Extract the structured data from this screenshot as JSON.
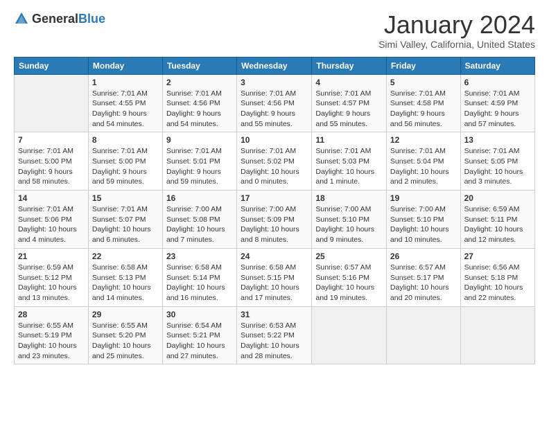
{
  "header": {
    "logo": {
      "general": "General",
      "blue": "Blue"
    },
    "title": "January 2024",
    "location": "Simi Valley, California, United States"
  },
  "calendar": {
    "weekdays": [
      "Sunday",
      "Monday",
      "Tuesday",
      "Wednesday",
      "Thursday",
      "Friday",
      "Saturday"
    ],
    "weeks": [
      [
        {
          "day": "",
          "info": ""
        },
        {
          "day": "1",
          "info": "Sunrise: 7:01 AM\nSunset: 4:55 PM\nDaylight: 9 hours\nand 54 minutes."
        },
        {
          "day": "2",
          "info": "Sunrise: 7:01 AM\nSunset: 4:56 PM\nDaylight: 9 hours\nand 54 minutes."
        },
        {
          "day": "3",
          "info": "Sunrise: 7:01 AM\nSunset: 4:56 PM\nDaylight: 9 hours\nand 55 minutes."
        },
        {
          "day": "4",
          "info": "Sunrise: 7:01 AM\nSunset: 4:57 PM\nDaylight: 9 hours\nand 55 minutes."
        },
        {
          "day": "5",
          "info": "Sunrise: 7:01 AM\nSunset: 4:58 PM\nDaylight: 9 hours\nand 56 minutes."
        },
        {
          "day": "6",
          "info": "Sunrise: 7:01 AM\nSunset: 4:59 PM\nDaylight: 9 hours\nand 57 minutes."
        }
      ],
      [
        {
          "day": "7",
          "info": "Sunrise: 7:01 AM\nSunset: 5:00 PM\nDaylight: 9 hours\nand 58 minutes."
        },
        {
          "day": "8",
          "info": "Sunrise: 7:01 AM\nSunset: 5:00 PM\nDaylight: 9 hours\nand 59 minutes."
        },
        {
          "day": "9",
          "info": "Sunrise: 7:01 AM\nSunset: 5:01 PM\nDaylight: 9 hours\nand 59 minutes."
        },
        {
          "day": "10",
          "info": "Sunrise: 7:01 AM\nSunset: 5:02 PM\nDaylight: 10 hours\nand 0 minutes."
        },
        {
          "day": "11",
          "info": "Sunrise: 7:01 AM\nSunset: 5:03 PM\nDaylight: 10 hours\nand 1 minute."
        },
        {
          "day": "12",
          "info": "Sunrise: 7:01 AM\nSunset: 5:04 PM\nDaylight: 10 hours\nand 2 minutes."
        },
        {
          "day": "13",
          "info": "Sunrise: 7:01 AM\nSunset: 5:05 PM\nDaylight: 10 hours\nand 3 minutes."
        }
      ],
      [
        {
          "day": "14",
          "info": "Sunrise: 7:01 AM\nSunset: 5:06 PM\nDaylight: 10 hours\nand 4 minutes."
        },
        {
          "day": "15",
          "info": "Sunrise: 7:01 AM\nSunset: 5:07 PM\nDaylight: 10 hours\nand 6 minutes."
        },
        {
          "day": "16",
          "info": "Sunrise: 7:00 AM\nSunset: 5:08 PM\nDaylight: 10 hours\nand 7 minutes."
        },
        {
          "day": "17",
          "info": "Sunrise: 7:00 AM\nSunset: 5:09 PM\nDaylight: 10 hours\nand 8 minutes."
        },
        {
          "day": "18",
          "info": "Sunrise: 7:00 AM\nSunset: 5:10 PM\nDaylight: 10 hours\nand 9 minutes."
        },
        {
          "day": "19",
          "info": "Sunrise: 7:00 AM\nSunset: 5:10 PM\nDaylight: 10 hours\nand 10 minutes."
        },
        {
          "day": "20",
          "info": "Sunrise: 6:59 AM\nSunset: 5:11 PM\nDaylight: 10 hours\nand 12 minutes."
        }
      ],
      [
        {
          "day": "21",
          "info": "Sunrise: 6:59 AM\nSunset: 5:12 PM\nDaylight: 10 hours\nand 13 minutes."
        },
        {
          "day": "22",
          "info": "Sunrise: 6:58 AM\nSunset: 5:13 PM\nDaylight: 10 hours\nand 14 minutes."
        },
        {
          "day": "23",
          "info": "Sunrise: 6:58 AM\nSunset: 5:14 PM\nDaylight: 10 hours\nand 16 minutes."
        },
        {
          "day": "24",
          "info": "Sunrise: 6:58 AM\nSunset: 5:15 PM\nDaylight: 10 hours\nand 17 minutes."
        },
        {
          "day": "25",
          "info": "Sunrise: 6:57 AM\nSunset: 5:16 PM\nDaylight: 10 hours\nand 19 minutes."
        },
        {
          "day": "26",
          "info": "Sunrise: 6:57 AM\nSunset: 5:17 PM\nDaylight: 10 hours\nand 20 minutes."
        },
        {
          "day": "27",
          "info": "Sunrise: 6:56 AM\nSunset: 5:18 PM\nDaylight: 10 hours\nand 22 minutes."
        }
      ],
      [
        {
          "day": "28",
          "info": "Sunrise: 6:55 AM\nSunset: 5:19 PM\nDaylight: 10 hours\nand 23 minutes."
        },
        {
          "day": "29",
          "info": "Sunrise: 6:55 AM\nSunset: 5:20 PM\nDaylight: 10 hours\nand 25 minutes."
        },
        {
          "day": "30",
          "info": "Sunrise: 6:54 AM\nSunset: 5:21 PM\nDaylight: 10 hours\nand 27 minutes."
        },
        {
          "day": "31",
          "info": "Sunrise: 6:53 AM\nSunset: 5:22 PM\nDaylight: 10 hours\nand 28 minutes."
        },
        {
          "day": "",
          "info": ""
        },
        {
          "day": "",
          "info": ""
        },
        {
          "day": "",
          "info": ""
        }
      ]
    ]
  }
}
